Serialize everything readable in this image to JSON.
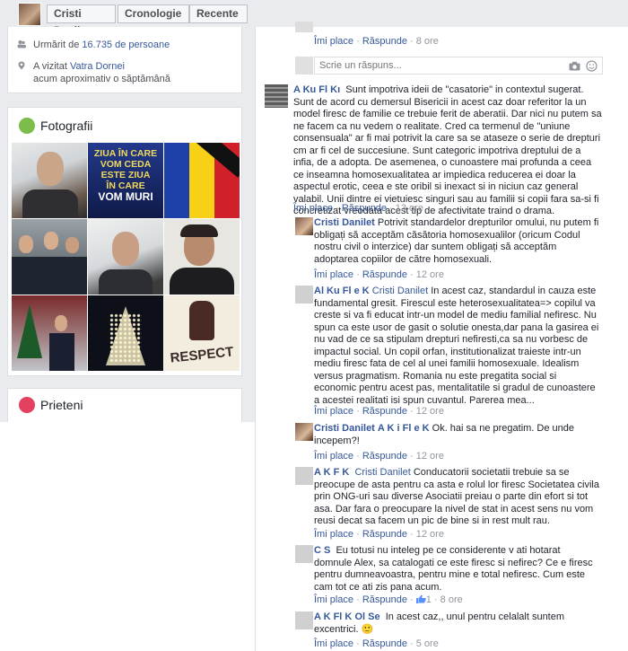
{
  "header": {
    "profile_name": "Cristi Danilet",
    "timeline_label": "Cronologie",
    "recent_label": "Recente"
  },
  "intro": {
    "followed_prefix": "Urmărit de ",
    "followed_count": "16.735 de persoane",
    "visited_prefix": "A vizitat ",
    "visited_place": "Vatra Dornei",
    "visited_time": "acum aproximativ o săptămână"
  },
  "photos": {
    "title": "Fotografii",
    "banner_text": [
      "ZIUA ÎN CARE",
      "VOM CEDA",
      "ESTE ZIUA",
      "ÎN CARE",
      "VOM MURI"
    ],
    "respect_text": "RESPECT"
  },
  "friends": {
    "title": "Prieteni"
  },
  "comments": {
    "like": "Îmi place",
    "reply": "Răspunde",
    "sep": " · ",
    "reply_placeholder": "Scrie un răspuns...",
    "top_time": "8 ore",
    "c1": {
      "author": "A     Ku     Fl     Kı",
      "text": "Sunt impotriva ideii de \"casatorie\" in contextul sugerat. Sunt de acord cu demersul Bisericii in acest caz doar referitor la un model firesc de familie ce trebuie ferit de aberatii. Dar nici nu putem sa ne facem ca nu vedem o realitate. Cred ca termenul de \"uniune consensuala\" ar fi mai potrivit la care sa se ataseze o serie de drepturi cm ar fi cel de succesiune. Sunt categoric impotriva dreptului de a infia, de a adopta. De asemenea, o cunoastere mai profunda a ceea ce inseamna homosexualitatea ar impiedica reducerea ei doar la aspectul erotic, ceea e ste oribil si inexact si in niciun caz general valabil. Unii dintre ei vietuiesc singuri sau au familii si copii fara sa-si fi concretizat vreodata acest tip de afectivitate traind o drama.",
      "time": "13 ore"
    },
    "c2": {
      "author": "Cristi Danilet",
      "text": "Potrivit standardelor drepturilor omului, nu putem fi obligați să acceptăm căsătoria homosexualilor (oricum Codul nostru civil o interzice) dar suntem obligați să acceptăm adoptarea copiilor de către homosexuali.",
      "time": "12 ore"
    },
    "c3": {
      "author": "Al     Ku     Fl     e K",
      "mention": "Cristi Danilet",
      "text": "In acest caz, standardul in cauza este fundamental gresit. Firescul este heterosexualitatea=> copilul va creste si va fi educat intr-un model de mediu familial nefiresc. Nu spun ca este usor de gasit o solutie onesta,dar pana la gasirea ei nu vad de ce sa stipulam drepturi nefiresti,ca sa nu vorbesc de impactul social. Un copil orfan, institutionalizat traieste intr-un mediu firesc fata de cel al unei familii homosexuale. Idealism versus pragmatism. Romania nu este pregatita social si economic pentru acest pas, mentalitatile si gradul de cunoastere a acestei realitati isi spun cuvantul. Parerea mea...",
      "time": "12 ore"
    },
    "c4": {
      "author": "Cristi Danilet",
      "mention": "A     K     i  Fl     e K",
      "text": "Ok. hai sa ne pregatim. De unde incepem?!",
      "time": "12 ore"
    },
    "c5": {
      "author": "A     K     F     K",
      "mention": "Cristi Danilet",
      "text": "Conducatorii societatii trebuie sa se preocupe de asta pentru ca asta e rolul lor firesc Societatea civila prin ONG-uri sau diverse Asociatii preiau o parte din efort si tot asa. Dar fara o preocupare la nivel de stat in acest sens nu vom reusi decat sa facem un pic de bine si in rest mult rau.",
      "time": "12 ore"
    },
    "c6": {
      "author": "C     S",
      "text": "Eu totusi nu inteleg pe ce considerente v ati hotarat domnule Alex, sa catalogati ce este firesc si nefirec? Ce e firesc pentru dumneavoastra, pentru mine e total nefiresc. Cum este cam tot ce ati zis pana acum.",
      "like_count": "1",
      "time": "8 ore"
    },
    "c7": {
      "author": "A     K     Fl     K",
      "mention": "Ol     Se",
      "text": "In acest caz,, unul pentru celalalt suntem excentrici. 🙂",
      "time": "5 ore"
    }
  }
}
